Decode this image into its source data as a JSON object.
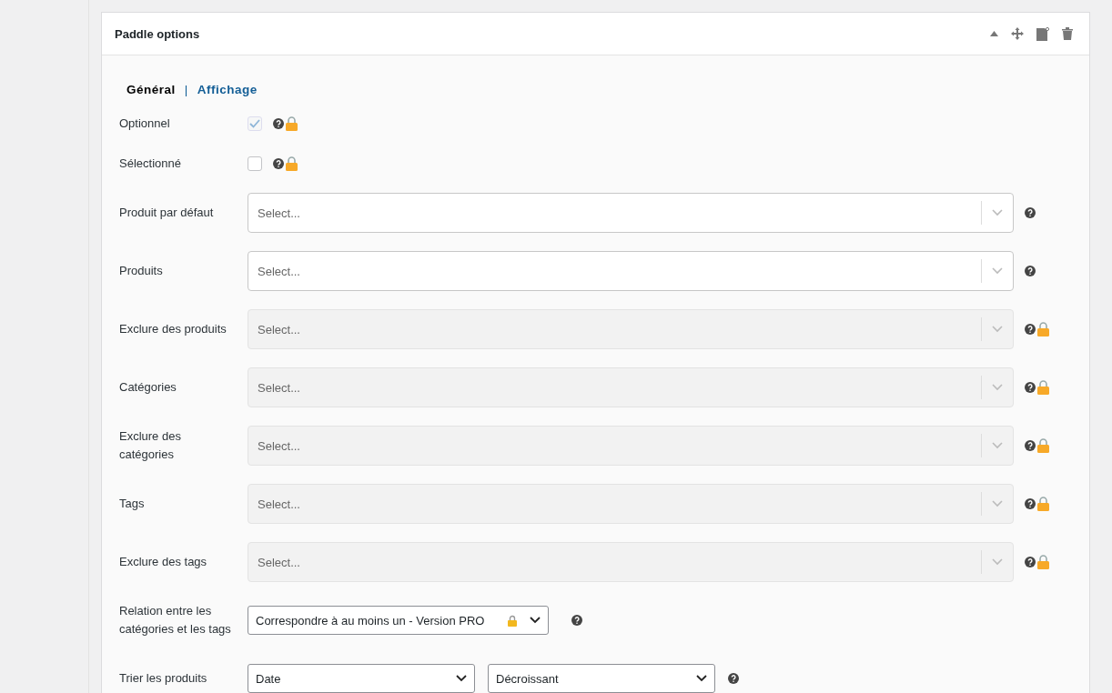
{
  "panel": {
    "title": "Paddle options"
  },
  "tabs": [
    {
      "label": "Général",
      "selected": true
    },
    {
      "label": "Affichage",
      "selected": false
    }
  ],
  "tab_separator": "|",
  "fields": [
    {
      "kind": "checkbox",
      "label": "Optionnel",
      "checked": true,
      "disabled": true,
      "locked": true
    },
    {
      "kind": "checkbox",
      "label": "Sélectionné",
      "checked": false,
      "disabled": false,
      "locked": true
    },
    {
      "kind": "multiselect",
      "label": "Produit par défaut",
      "placeholder": "Select...",
      "disabled": false,
      "locked": false
    },
    {
      "kind": "multiselect",
      "label": "Produits",
      "placeholder": "Select...",
      "disabled": false,
      "locked": false
    },
    {
      "kind": "multiselect",
      "label": "Exclure des produits",
      "placeholder": "Select...",
      "disabled": true,
      "locked": true
    },
    {
      "kind": "multiselect",
      "label": "Catégories",
      "placeholder": "Select...",
      "disabled": true,
      "locked": true
    },
    {
      "kind": "multiselect",
      "label": "Exclure des catégories",
      "placeholder": "Select...",
      "disabled": true,
      "locked": true
    },
    {
      "kind": "multiselect",
      "label": "Tags",
      "placeholder": "Select...",
      "disabled": true,
      "locked": true
    },
    {
      "kind": "multiselect",
      "label": "Exclure des tags",
      "placeholder": "Select...",
      "disabled": true,
      "locked": true
    },
    {
      "kind": "dropdown",
      "label": "Relation entre les catégories et les tags",
      "values": [
        "Correspondre à au moins un - Version PRO"
      ],
      "value_locked": true,
      "locked": false
    },
    {
      "kind": "dropdown",
      "label": "Trier les produits",
      "values": [
        "Date",
        "Décroissant"
      ],
      "value_locked": false,
      "locked": false
    }
  ]
}
